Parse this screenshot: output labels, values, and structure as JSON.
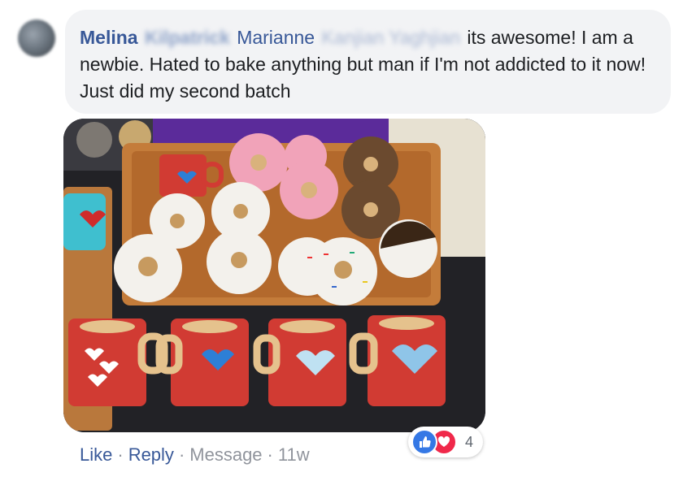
{
  "comment": {
    "author": "Melina",
    "author_surname_blurred": "Kilpatrick",
    "tagged_name": "Marianne",
    "tagged_surname_blurred": "Kanjian Yaghjian",
    "text": "its awesome! I am a newbie. Hated to bake anything but man if I'm not addicted to it now! Just did my second batch"
  },
  "photo": {
    "alt": "Tray of decorated donut and coffee-mug cookies"
  },
  "actions": {
    "like": "Like",
    "reply": "Reply",
    "message": "Message",
    "separator": "·",
    "time": "11w"
  },
  "reactions": {
    "count": "4",
    "types": [
      "like-icon",
      "love-icon"
    ]
  },
  "colors": {
    "link": "#385898",
    "bubble": "#f2f3f5",
    "meta": "#90949c",
    "like": "#3578e5",
    "love": "#f0284a"
  }
}
